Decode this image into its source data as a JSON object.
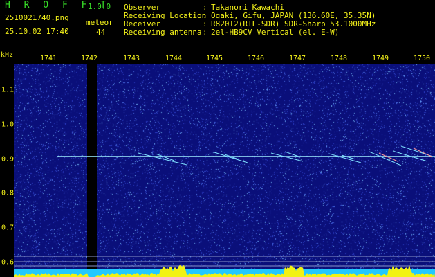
{
  "header": {
    "app_title": "H R O F F T",
    "app_version": "1.0.0",
    "file_name": "2510021740.png",
    "timestamp": "25.10.02 17:40",
    "meteor_label": "meteor",
    "meteor_count": "44"
  },
  "info": [
    {
      "label": "Observer",
      "sep": ":",
      "value": "Takanori Kawachi"
    },
    {
      "label": "Receiving Location",
      "sep": ":",
      "value": "Ogaki, Gifu, JAPAN (136.60E, 35.35N)"
    },
    {
      "label": "Receiver",
      "sep": ":",
      "value": "R820T2(RTL-SDR) SDR-Sharp 53.1000MHz"
    },
    {
      "label": "Receiving antenna",
      "sep": ":",
      "value": "2el-HB9CV Vertical (el. E-W)"
    }
  ],
  "axis": {
    "unit": "kHz",
    "time_ticks": [
      "1741",
      "1742",
      "1743",
      "1744",
      "1745",
      "1746",
      "1747",
      "1748",
      "1749",
      "1750"
    ],
    "freq_ticks": [
      "1.1",
      "1.0",
      "0.9",
      "0.8",
      "0.7",
      "0.6"
    ]
  },
  "colors": {
    "background": "#0a0f7a",
    "carrier": "#9ff0ff",
    "meteor_trail": "#7fe0ff",
    "level_bar": "#f2f213",
    "baseline": "#22c8ff",
    "gap": "#000000"
  }
}
